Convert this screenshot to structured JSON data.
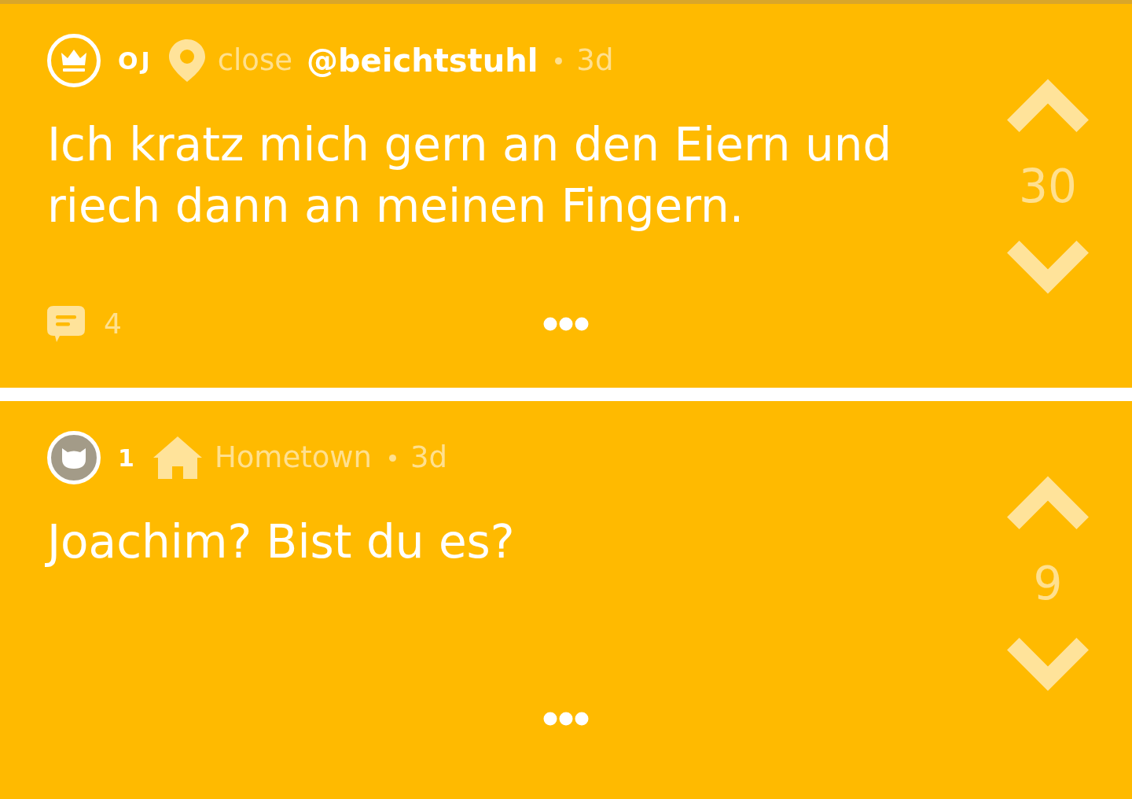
{
  "posts": [
    {
      "avatar": {
        "kind": "crown"
      },
      "author": "OJ",
      "location": {
        "kind": "pin",
        "label": "close"
      },
      "channel": "@beichtstuhl",
      "time": "3d",
      "text": "Ich kratz mich gern an den Eiern und riech dann an meinen Fingern.",
      "votes": "30",
      "comments": "4"
    },
    {
      "avatar": {
        "kind": "cat"
      },
      "author": "1",
      "location": {
        "kind": "home",
        "label": "Hometown"
      },
      "time": "3d",
      "text": "Joachim? Bist du es?",
      "votes": "9"
    }
  ]
}
